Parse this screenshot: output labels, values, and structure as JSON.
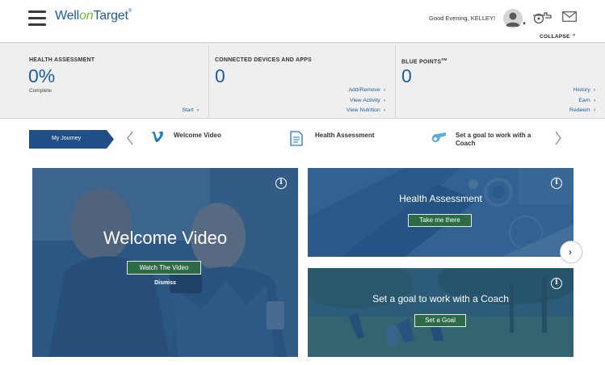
{
  "header": {
    "logo_well": "Well",
    "logo_on": "on",
    "logo_target": "Target",
    "logo_mark": "®",
    "greeting": "Good Evening, KELLEY!",
    "collapse_label": "COLLAPSE"
  },
  "stats": [
    {
      "title": "HEALTH ASSESSMENT",
      "value": "0%",
      "sub": "Complete",
      "links": [
        "Start"
      ]
    },
    {
      "title": "CONNECTED DEVICES AND APPS",
      "value": "0",
      "links": [
        "Add/Remove",
        "View Activity",
        "View Nutrition"
      ]
    },
    {
      "title": "BLUE POINTS",
      "title_sup": "SM",
      "value": "0",
      "links": [
        "History",
        "Earn",
        "Redeem"
      ]
    }
  ],
  "journey": {
    "tab_label": "My Journey",
    "items": [
      {
        "label": "Welcome Video",
        "icon": "vimeo-icon"
      },
      {
        "label": "Health Assessment",
        "icon": "document-icon"
      },
      {
        "label": "Set a goal to work with a Coach",
        "icon": "whistle-icon"
      }
    ]
  },
  "cards": {
    "welcome": {
      "title": "Welcome Video",
      "button": "Watch The Video",
      "dismiss": "Dismiss"
    },
    "assessment": {
      "title": "Health Assessment",
      "button": "Take me there"
    },
    "coach": {
      "title": "Set a goal to work with a Coach",
      "button": "Set a Goal"
    }
  },
  "colors": {
    "brand_blue": "#1b5e9c",
    "journey_tab": "#1f4f86",
    "button_green": "#2c6b45",
    "logo_green": "#6fb43f"
  }
}
